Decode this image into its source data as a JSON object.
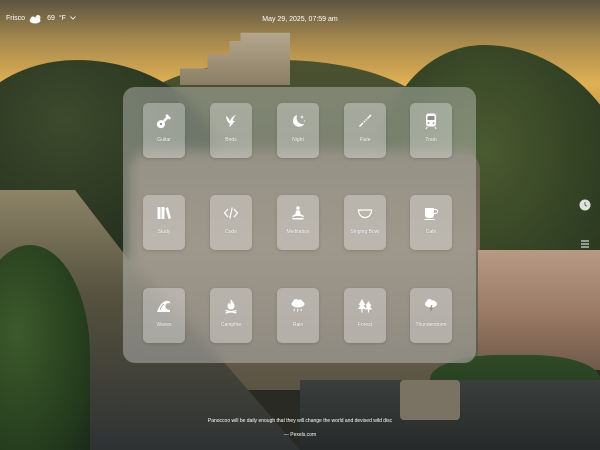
{
  "weather": {
    "location": "Frisco",
    "temperature": "69",
    "unit": "°F",
    "icon": "partly-cloudy-icon"
  },
  "datetime": "May 29, 2025, 07:59 am",
  "side_controls": [
    {
      "name": "clock-icon"
    },
    {
      "name": "menu-icon"
    }
  ],
  "tiles": [
    {
      "label": "Guitar",
      "icon": "guitar-icon"
    },
    {
      "label": "Birds",
      "icon": "bird-icon"
    },
    {
      "label": "Night",
      "icon": "moon-stars-icon"
    },
    {
      "label": "Flute",
      "icon": "flute-icon"
    },
    {
      "label": "Train",
      "icon": "train-icon"
    },
    {
      "label": "Study",
      "icon": "books-icon"
    },
    {
      "label": "Code",
      "icon": "code-icon"
    },
    {
      "label": "Meditation",
      "icon": "meditation-icon"
    },
    {
      "label": "Singing Bowl",
      "icon": "singing-bowl-icon"
    },
    {
      "label": "Cafe",
      "icon": "coffee-cup-icon"
    },
    {
      "label": "Waves",
      "icon": "wave-icon"
    },
    {
      "label": "Campfire",
      "icon": "campfire-icon"
    },
    {
      "label": "Rain",
      "icon": "rain-cloud-icon"
    },
    {
      "label": "Forest",
      "icon": "forest-icon"
    },
    {
      "label": "Thunderstorm",
      "icon": "thunderstorm-icon"
    }
  ],
  "footer": {
    "message": "Panoccoo will be daily enough that they will change the world and devised wild disc",
    "link": "— Pexels.com"
  }
}
